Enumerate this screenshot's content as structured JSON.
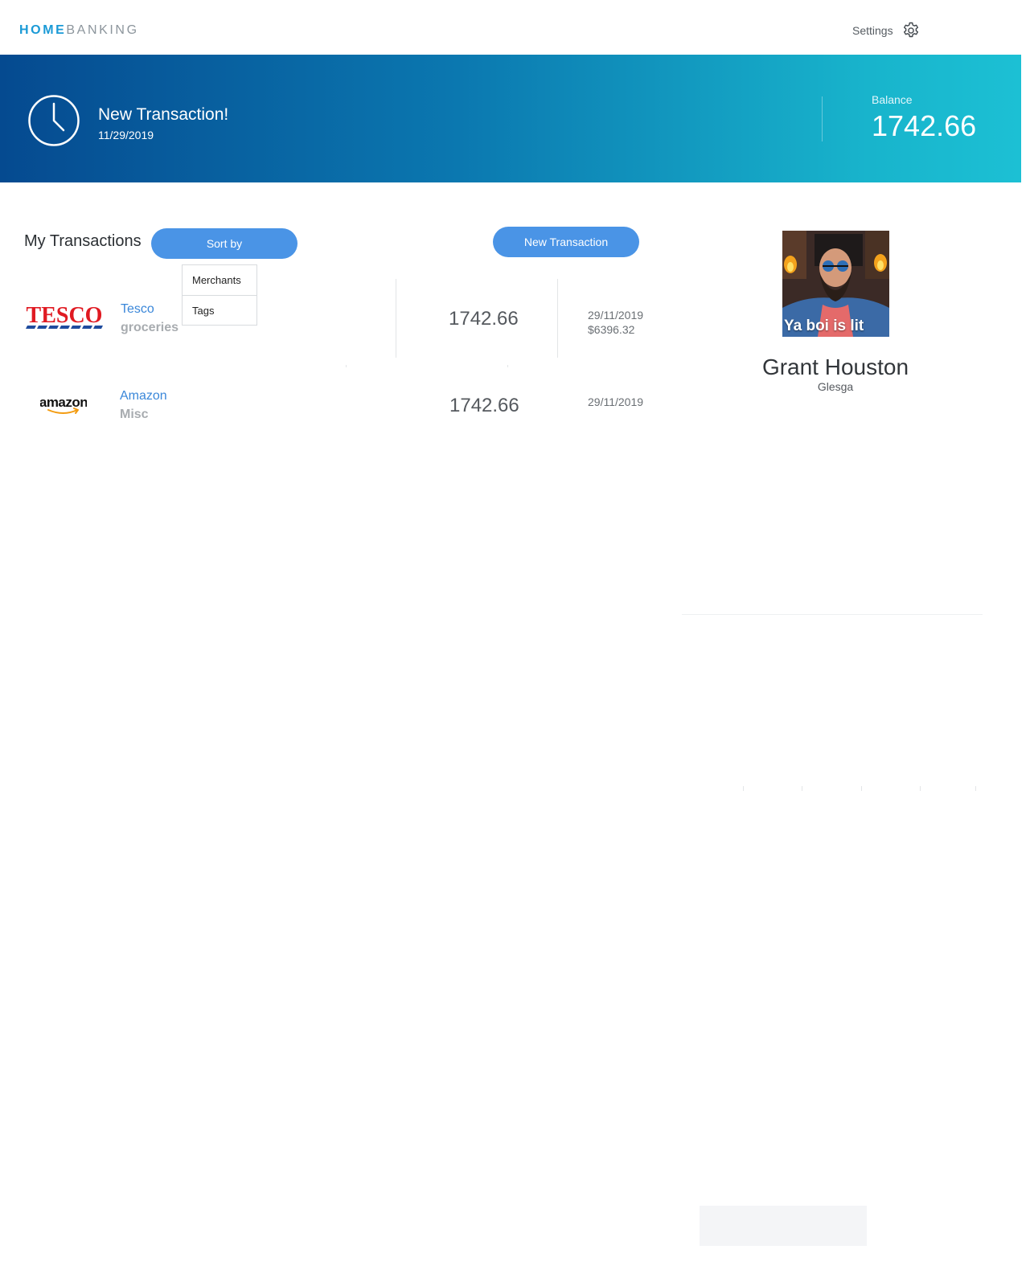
{
  "nav": {
    "brand_home": "HOME",
    "brand_banking": "BANKING",
    "settings_label": "Settings",
    "settings_icon": "gear-icon"
  },
  "hero": {
    "icon": "clock-icon",
    "title": "New Transaction!",
    "date": "11/29/2019",
    "balance_label": "Balance",
    "balance_value": "1742.66",
    "gradient": [
      "#054a90",
      "#1cc0d4"
    ]
  },
  "transactions": {
    "title": "My Transactions",
    "sort_label": "Sort by",
    "sort_options": [
      "Merchants",
      "Tags"
    ],
    "new_label": "New Transaction",
    "items": [
      {
        "merchant": "Tesco",
        "tag": "groceries",
        "logo_text": "TESCO",
        "amount": "1742.66",
        "date": "29/11/2019",
        "extra": "$6396.32"
      },
      {
        "merchant": "Amazon",
        "tag": "Misc",
        "logo_text": "amazon",
        "amount": "1742.66",
        "date": "29/11/2019"
      }
    ]
  },
  "profile": {
    "caption": "Ya boi is lit",
    "name": "Grant Houston",
    "location": "Glesga"
  },
  "colors": {
    "accent": "#4a94e6",
    "link": "#3a87d9",
    "brand_blue": "#1a9ad6"
  }
}
